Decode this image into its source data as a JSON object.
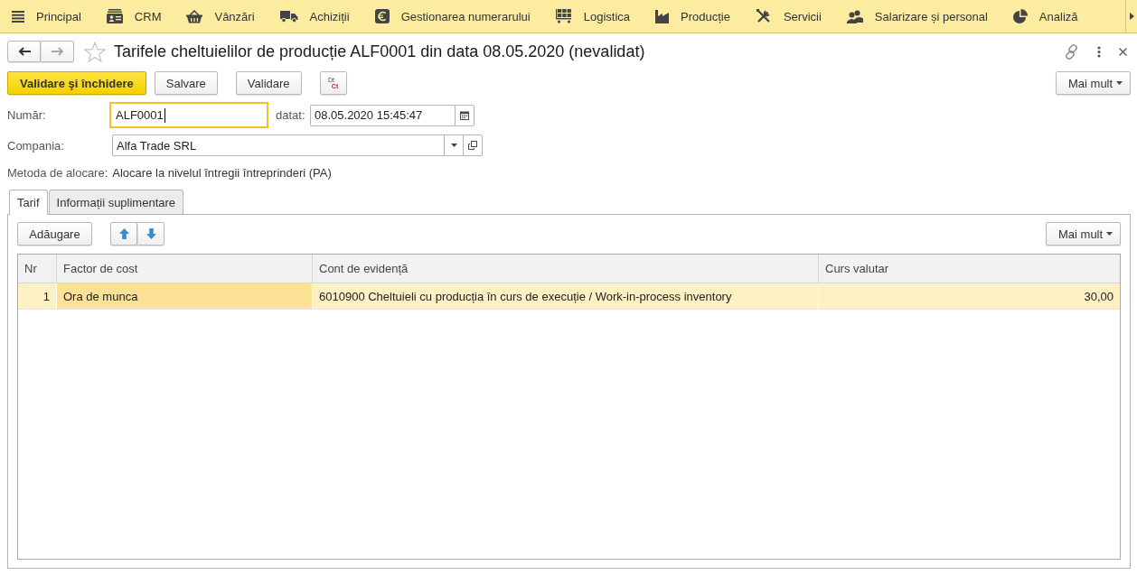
{
  "menu": [
    {
      "label": "Principal"
    },
    {
      "label": "CRM"
    },
    {
      "label": "Vânzări"
    },
    {
      "label": "Achiziții"
    },
    {
      "label": "Gestionarea numerarului"
    },
    {
      "label": "Logistica"
    },
    {
      "label": "Producție"
    },
    {
      "label": "Servicii"
    },
    {
      "label": "Salarizare și personal"
    },
    {
      "label": "Analiză"
    }
  ],
  "header": {
    "back": {
      "disabled": false
    },
    "forward": {
      "disabled": true
    },
    "favorite": false,
    "title": "Tarifele cheltuielilor de producție ALF0001 din data 08.05.2020 (nevalidat)"
  },
  "toolbar": {
    "buttons": [
      {
        "kind": "primary",
        "label": "Validare şi închidere"
      },
      {
        "kind": "default",
        "label": "Salvare"
      },
      {
        "kind": "default",
        "label": "Validare"
      },
      {
        "kind": "dtct",
        "label": "Dt",
        "label2": "Ct"
      }
    ],
    "more": "Mai mult"
  },
  "form": {
    "number": {
      "label": "Număr:",
      "value": "ALF0001",
      "focused": true
    },
    "date": {
      "label": "datat:",
      "value": "08.05.2020 15:45:47"
    },
    "company": {
      "label": "Compania:",
      "value": "Alfa Trade SRL"
    },
    "method": {
      "label": "Metoda de alocare:",
      "value": "Alocare la nivelul întregii întreprinderi (PA)"
    }
  },
  "tabs": [
    {
      "label": "Tarif",
      "selected": true
    },
    {
      "label": "Informații suplimentare",
      "selected": false
    }
  ],
  "table_toolbar": {
    "add": "Adăugare",
    "more": "Mai mult"
  },
  "table": {
    "columns": [
      "Nr",
      "Factor de cost",
      "Cont de evidență",
      "Curs valutar"
    ],
    "rows": [
      {
        "selected": true,
        "cells": [
          {
            "text": "1",
            "active": false
          },
          {
            "text": "Ora de munca",
            "active": true
          },
          {
            "text": "6010900 Cheltuieli cu producția în curs de execuție / Work-in-process inventory",
            "active": false
          },
          {
            "text": "30,00",
            "active": false
          }
        ]
      }
    ]
  }
}
